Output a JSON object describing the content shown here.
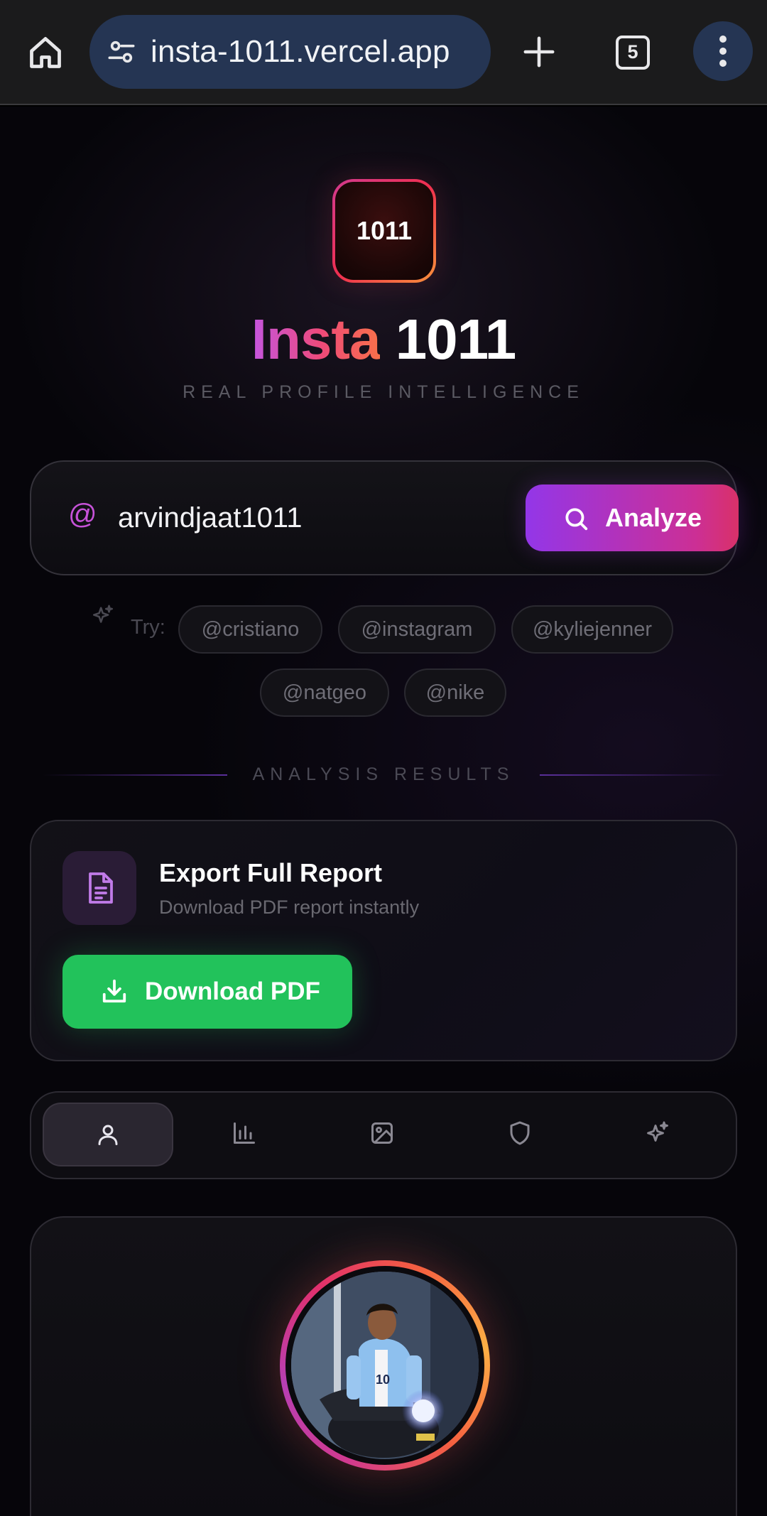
{
  "browser": {
    "url": "insta-1011.vercel.app",
    "tab_count": "5"
  },
  "app": {
    "logo_text": "1011",
    "brand_part1": "Insta",
    "brand_part2": "1011",
    "tagline": "REAL PROFILE INTELLIGENCE"
  },
  "search": {
    "at_symbol": "@",
    "value": "arvindjaat1011",
    "button_label": "Analyze"
  },
  "suggestions": {
    "label": "Try:",
    "chips": [
      "@cristiano",
      "@instagram",
      "@kyliejenner",
      "@natgeo",
      "@nike"
    ]
  },
  "results": {
    "divider_label": "ANALYSIS RESULTS"
  },
  "export": {
    "title": "Export Full Report",
    "subtitle": "Download PDF report instantly",
    "button_label": "Download PDF"
  },
  "tabs": [
    {
      "icon": "user-icon",
      "active": true
    },
    {
      "icon": "bar-chart-icon",
      "active": false
    },
    {
      "icon": "image-icon",
      "active": false
    },
    {
      "icon": "shield-icon",
      "active": false
    },
    {
      "icon": "sparkles-icon",
      "active": false
    }
  ],
  "colors": {
    "accent_purple": "#9336e8",
    "accent_pink": "#d93169",
    "success_green": "#22c25b",
    "background": "#06050a"
  }
}
